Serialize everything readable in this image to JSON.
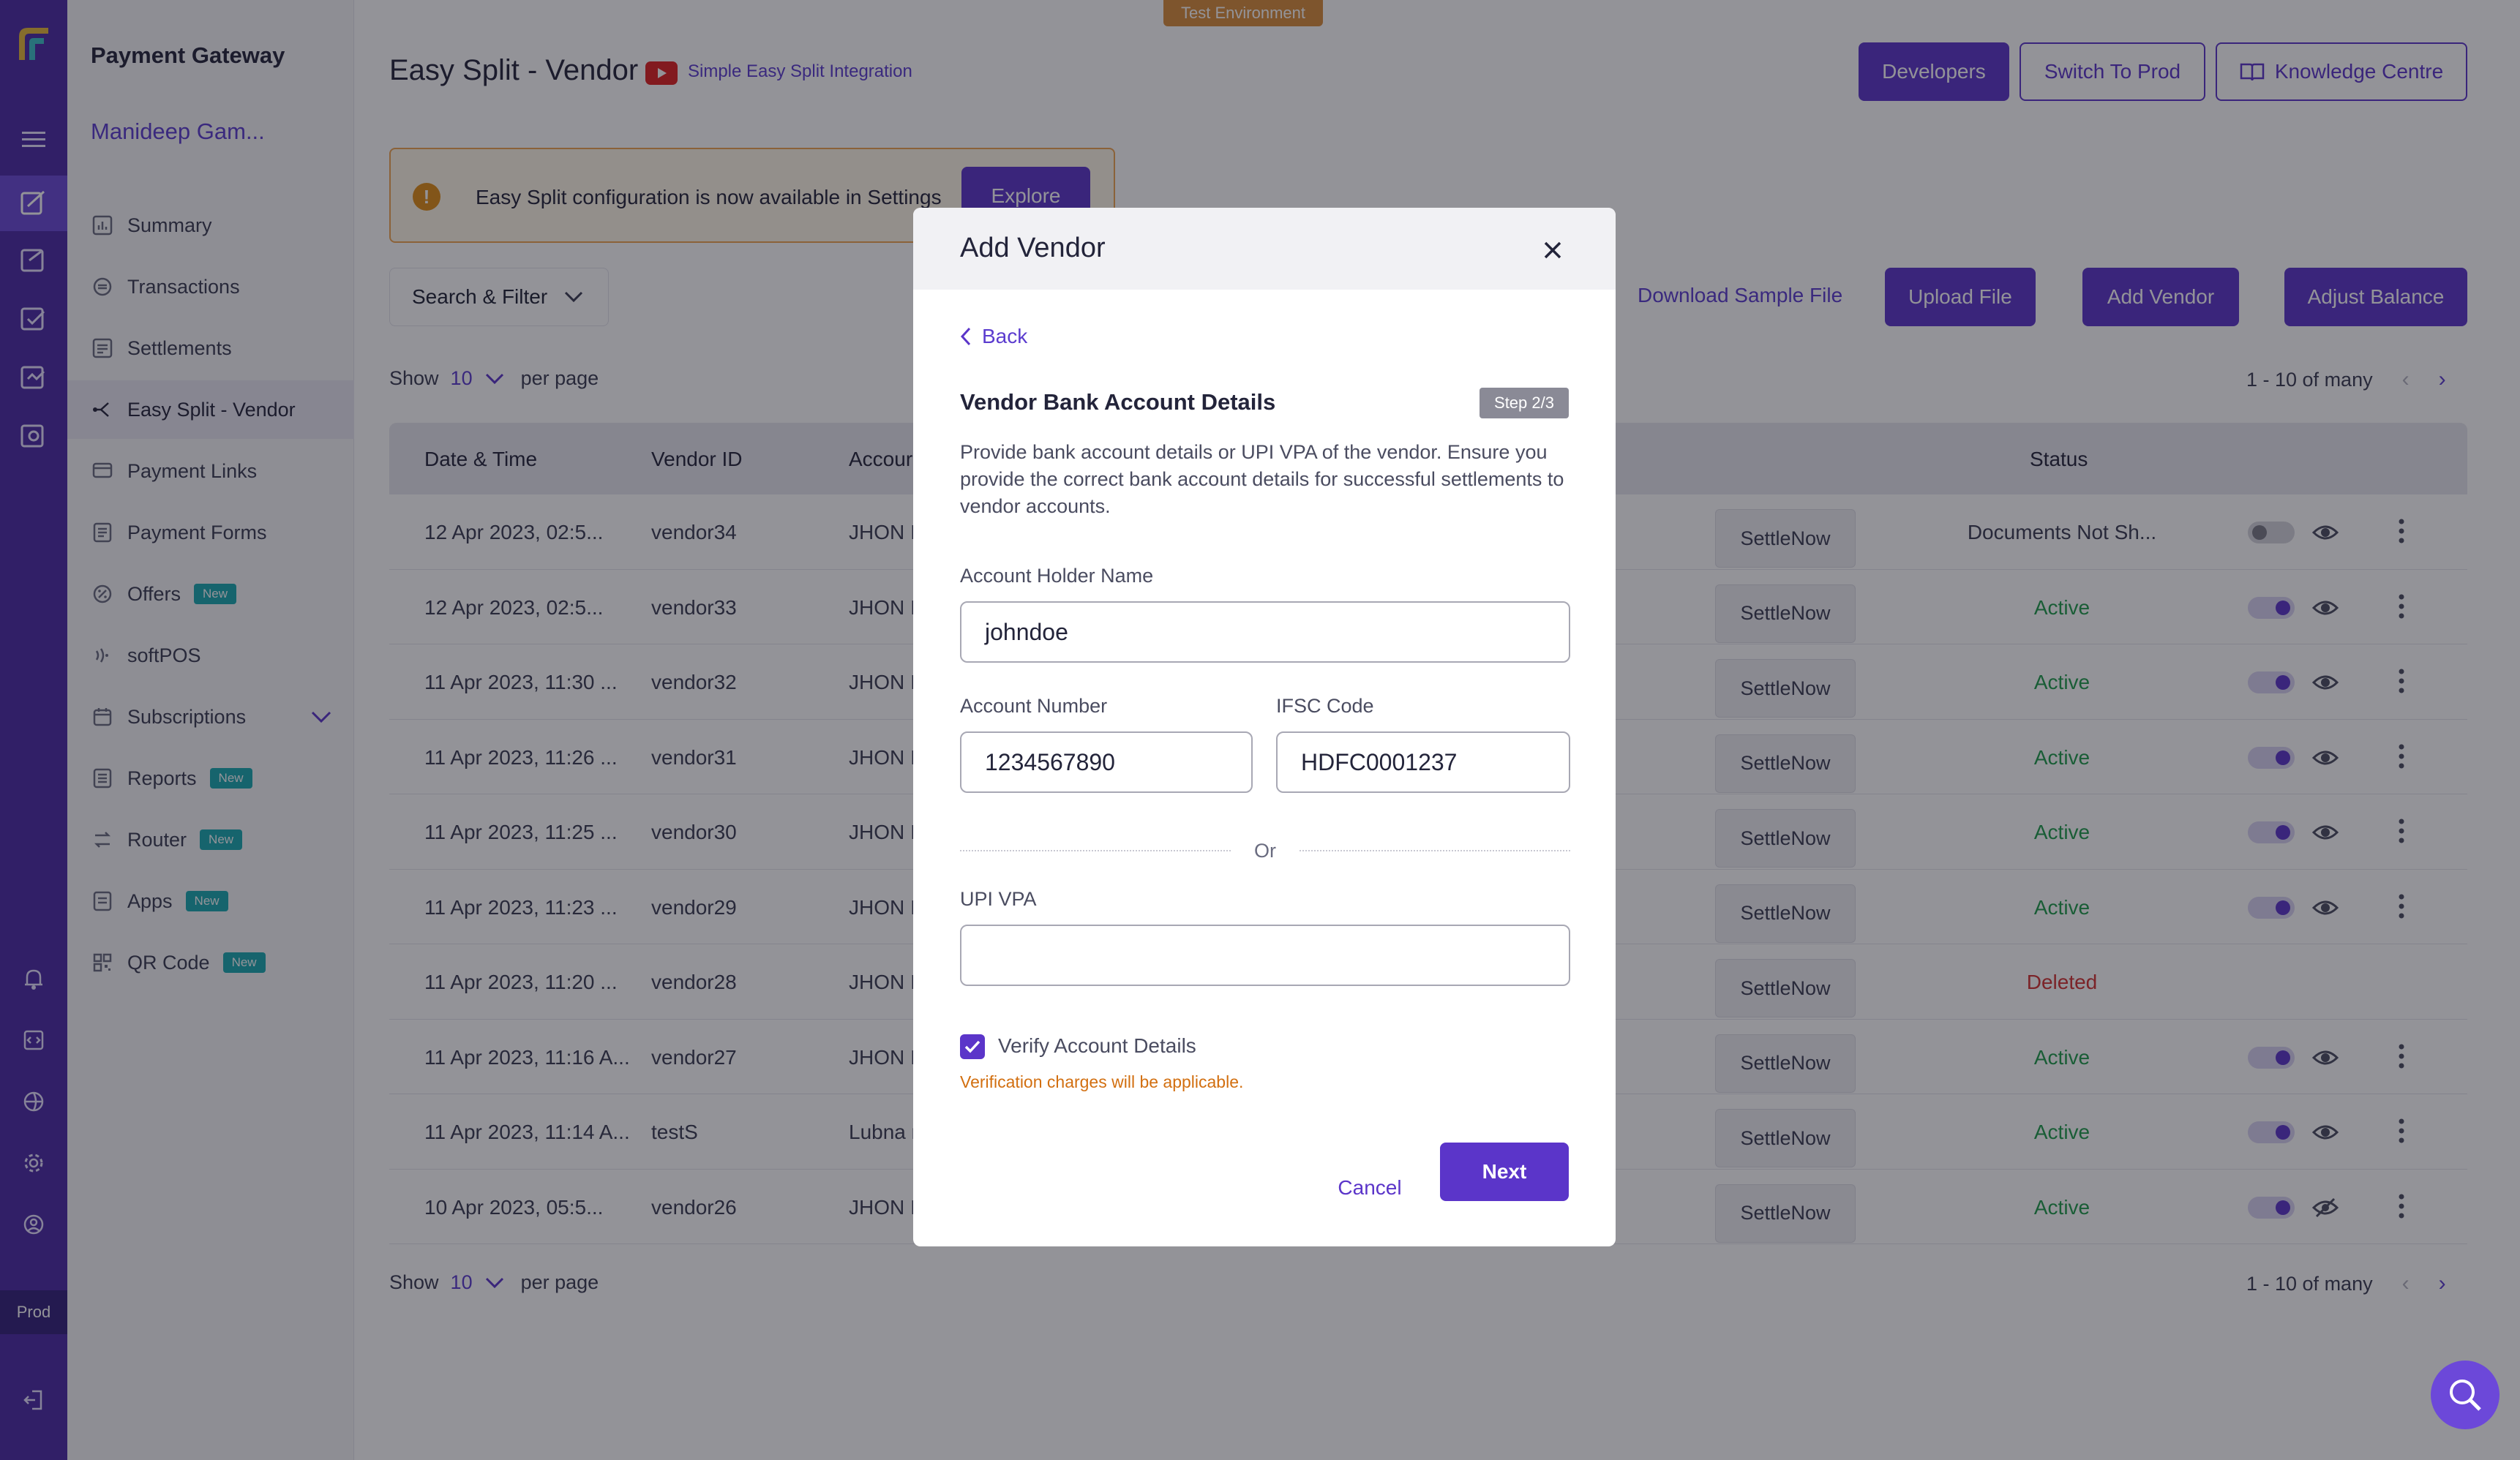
{
  "env_badge": "Test Environment",
  "sidebar": {
    "brand": "Payment Gateway",
    "merchant": "Manideep Gam...",
    "items": [
      {
        "label": "Summary",
        "new": ""
      },
      {
        "label": "Transactions",
        "new": ""
      },
      {
        "label": "Settlements",
        "new": ""
      },
      {
        "label": "Easy Split - Vendor",
        "new": ""
      },
      {
        "label": "Payment Links",
        "new": ""
      },
      {
        "label": "Payment Forms",
        "new": ""
      },
      {
        "label": "Offers",
        "new": "New"
      },
      {
        "label": "softPOS",
        "new": ""
      },
      {
        "label": "Subscriptions",
        "new": ""
      },
      {
        "label": "Reports",
        "new": "New"
      },
      {
        "label": "Router",
        "new": "New"
      },
      {
        "label": "Apps",
        "new": "New"
      },
      {
        "label": "QR Code",
        "new": "New"
      }
    ],
    "prod_label": "Prod"
  },
  "header": {
    "title": "Easy Split - Vendor",
    "video_link": "Simple Easy Split Integration",
    "developers": "Developers",
    "switch_prod": "Switch To Prod",
    "knowledge": "Knowledge Centre"
  },
  "banner": {
    "text": "Easy Split configuration is now available in Settings",
    "explore": "Explore"
  },
  "toolbar": {
    "search_filter": "Search & Filter",
    "download_sample": "Download Sample File",
    "upload": "Upload File",
    "add_vendor": "Add Vendor",
    "adjust_balance": "Adjust Balance"
  },
  "pagination": {
    "show": "Show",
    "per_page_value": "10",
    "per_page": "per page",
    "range": "1 - 10 of many"
  },
  "table": {
    "headers": [
      "Date & Time",
      "Vendor ID",
      "Accour",
      "Status"
    ],
    "settle_label": "SettleNow",
    "rows": [
      {
        "date": "12 Apr 2023, 02:5...",
        "vendor": "vendor34",
        "account": "JHON I",
        "status": "Documents Not Sh...",
        "state": "pending"
      },
      {
        "date": "12 Apr 2023, 02:5...",
        "vendor": "vendor33",
        "account": "JHON I",
        "status": "Active",
        "state": "active"
      },
      {
        "date": "11 Apr 2023, 11:30 ...",
        "vendor": "vendor32",
        "account": "JHON I",
        "status": "Active",
        "state": "active"
      },
      {
        "date": "11 Apr 2023, 11:26 ...",
        "vendor": "vendor31",
        "account": "JHON I",
        "status": "Active",
        "state": "active"
      },
      {
        "date": "11 Apr 2023, 11:25 ...",
        "vendor": "vendor30",
        "account": "JHON I",
        "status": "Active",
        "state": "active"
      },
      {
        "date": "11 Apr 2023, 11:23 ...",
        "vendor": "vendor29",
        "account": "JHON I",
        "status": "Active",
        "state": "active"
      },
      {
        "date": "11 Apr 2023, 11:20 ...",
        "vendor": "vendor28",
        "account": "JHON I",
        "status": "Deleted",
        "state": "deleted"
      },
      {
        "date": "11 Apr 2023, 11:16 A...",
        "vendor": "vendor27",
        "account": "JHON I",
        "status": "Active",
        "state": "active"
      },
      {
        "date": "11 Apr 2023, 11:14 A...",
        "vendor": "testS",
        "account": "Lubna r",
        "status": "Active",
        "state": "active"
      },
      {
        "date": "10 Apr 2023, 05:5...",
        "vendor": "vendor26",
        "account": "JHON I",
        "status": "Active",
        "state": "active-hidden"
      }
    ]
  },
  "modal": {
    "title": "Add Vendor",
    "back": "Back",
    "section_title": "Vendor Bank Account Details",
    "step": "Step 2/3",
    "description": "Provide bank account details or UPI VPA of the vendor. Ensure you provide the correct bank account details for successful settlements to vendor accounts.",
    "holder_label": "Account Holder Name",
    "holder_value": "johndoe",
    "account_label": "Account Number",
    "account_value": "1234567890",
    "ifsc_label": "IFSC Code",
    "ifsc_value": "HDFC0001237",
    "or": "Or",
    "upi_label": "UPI VPA",
    "upi_value": "",
    "verify_label": "Verify Account Details",
    "verify_checked": true,
    "verify_note": "Verification charges will be applicable.",
    "cancel": "Cancel",
    "next": "Next"
  },
  "colors": {
    "primary": "#5b35c9",
    "rail": "#4a2aa5",
    "active_status": "#1e9c4a",
    "deleted_status": "#d23030",
    "warning": "#d26f10"
  }
}
